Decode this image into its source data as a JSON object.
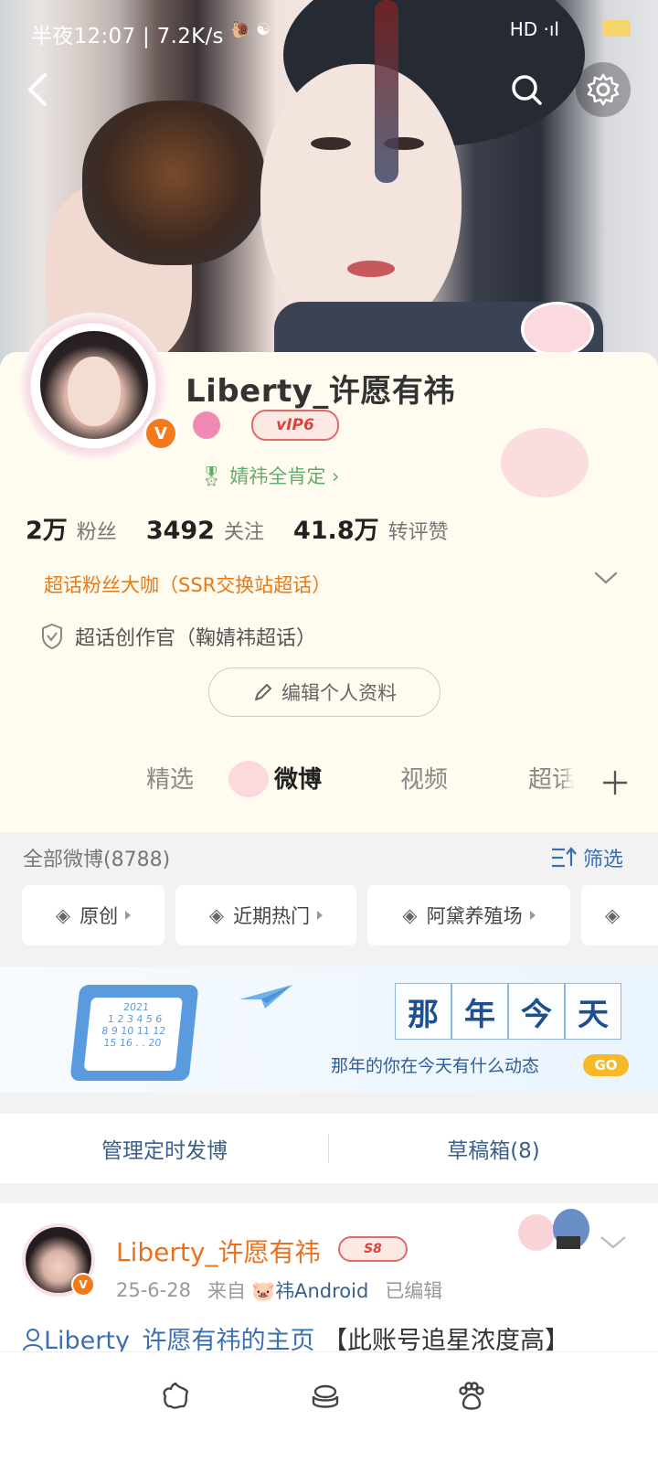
{
  "status_bar": {
    "time": "半夜12:07 | 7.2K/s",
    "extra_icons": "🐌 ☯",
    "network": "HD ·ıl",
    "battery_color": "#f5d56a"
  },
  "profile": {
    "name": "Liberty_许愿有祎",
    "vip_label": "vIP6",
    "verified_mark": "V",
    "motto": "婧祎全肯定",
    "stats": [
      {
        "value": "2万",
        "label": "粉丝"
      },
      {
        "value": "3492",
        "label": "关注"
      },
      {
        "value": "41.8万",
        "label": "转评赞"
      }
    ],
    "fan_title": "超话粉丝大咖（SSR交换站超话）",
    "creator_title": "超话创作官（鞠婧祎超话）",
    "edit_button": "编辑个人资料"
  },
  "tabs": [
    {
      "label": "精选",
      "active": false
    },
    {
      "label": "微博",
      "active": true
    },
    {
      "label": "视频",
      "active": false
    },
    {
      "label": "超话",
      "active": false
    }
  ],
  "filter": {
    "all_weibo": "全部微博(8788)",
    "filter_label": "筛选",
    "chips": [
      "原创",
      "近期热门",
      "阿黛养殖场",
      ""
    ]
  },
  "banner": {
    "title_chars": [
      "那",
      "年",
      "今",
      "天"
    ],
    "subtitle": "那年的你在今天有什么动态",
    "go": "GO",
    "calendar_year": "2021"
  },
  "manage": {
    "scheduled": "管理定时发博",
    "drafts": "草稿箱(8)"
  },
  "post": {
    "author": "Liberty_许愿有祎",
    "level_label": "S8",
    "date": "25-6-28",
    "from_label": "来自",
    "source": "🐷祎Android",
    "edited": "已编辑",
    "text_link": "Liberty_许愿有祎的主页",
    "text_rest": "【此账号追星浓度高】"
  },
  "colors": {
    "accent_orange": "#e8711d",
    "link_blue": "#3a6fb0",
    "card_bg": "#fffbef",
    "motto_green": "#5fae6a"
  }
}
